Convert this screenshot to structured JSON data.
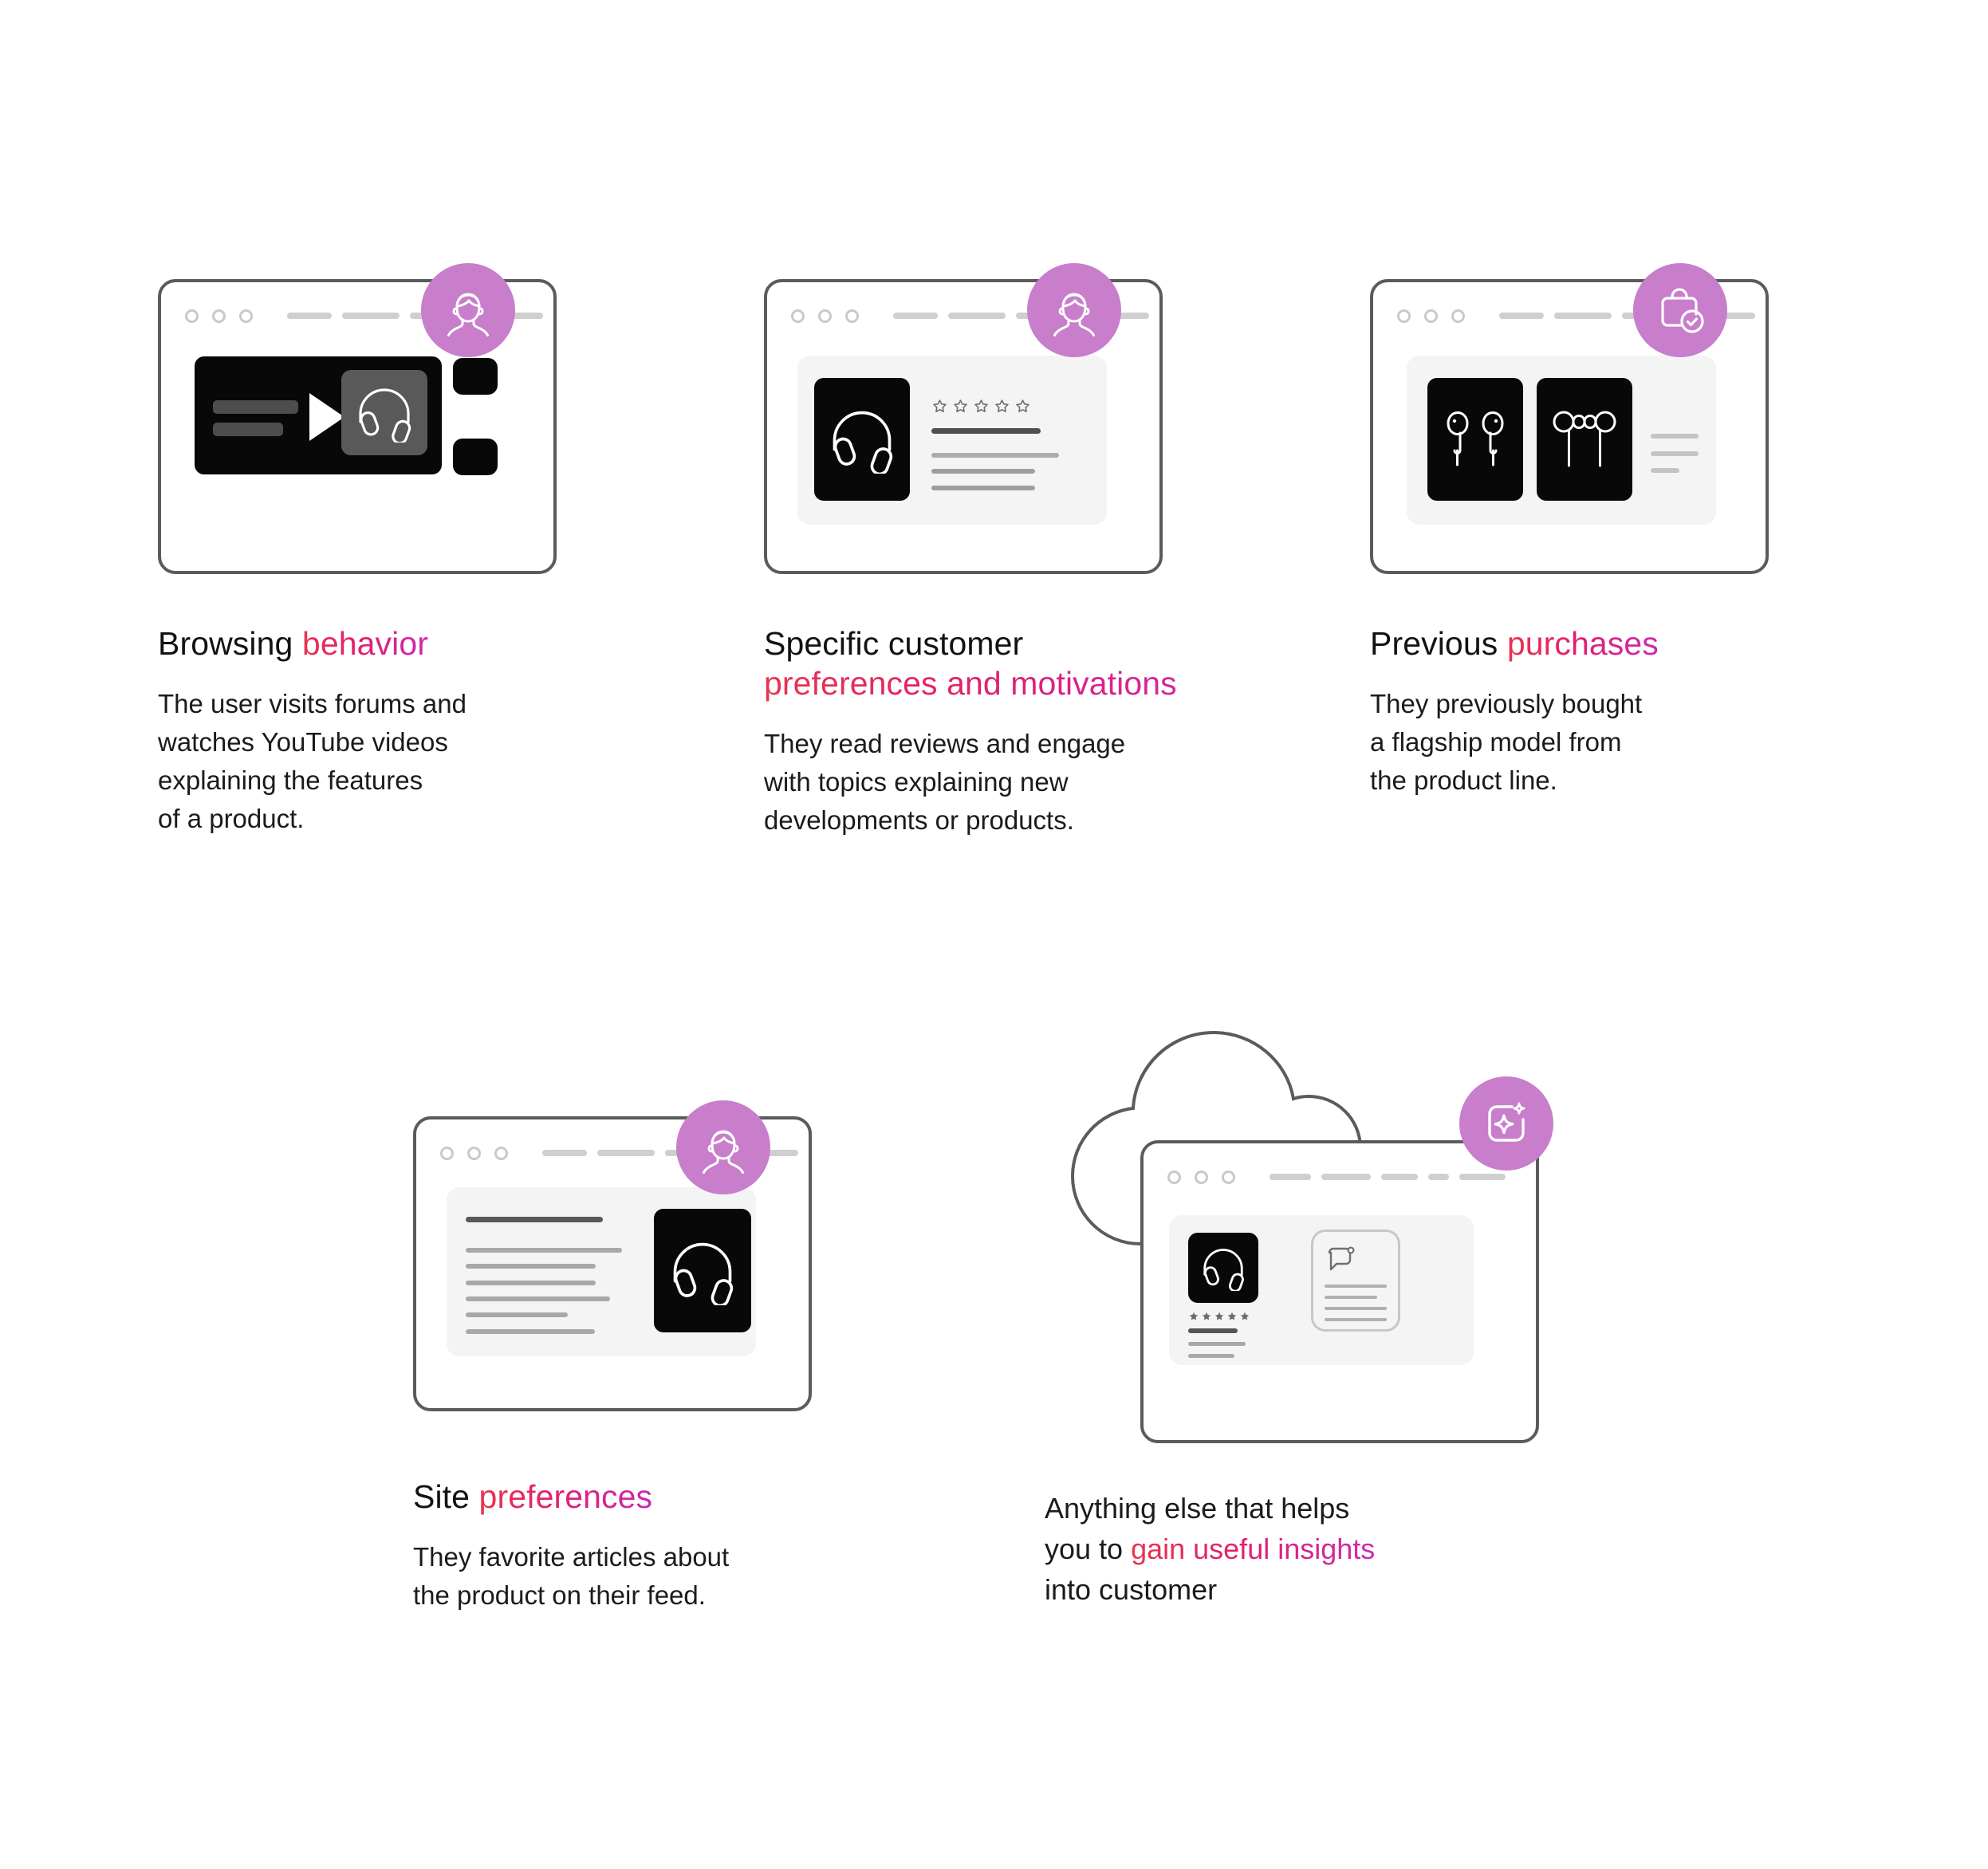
{
  "theme": {
    "badge_color": "#C87ECB",
    "accent_from": "#E8344E",
    "accent_to": "#CC28B4",
    "frame_stroke": "#5B5B5B",
    "panel_gray": "#F4F4F4",
    "tile_black": "#080808"
  },
  "cards": [
    {
      "id": "browsing-behavior",
      "badge_icon": "user-avatar-icon",
      "illustration": "video-player-window",
      "headline_plain": "Browsing ",
      "headline_accent": "behavior",
      "body": "The user visits forums and watches YouTube videos explaining the features of a product.",
      "body_lines": [
        "The user visits forums and",
        "watches YouTube videos",
        "explaining the features",
        "of a product."
      ]
    },
    {
      "id": "customer-preferences",
      "badge_icon": "user-avatar-icon",
      "illustration": "product-review-window",
      "headline_plain": "Specific customer",
      "headline_accent": "preferences and motivations",
      "body": "They read reviews and engage with topics explaining new developments or products.",
      "body_lines": [
        "They read reviews and engage",
        "with topics explaining new",
        "developments or products."
      ],
      "rating_stars": 5,
      "rating_style": "outline"
    },
    {
      "id": "previous-purchases",
      "badge_icon": "shopping-bag-check-icon",
      "illustration": "purchased-products-window",
      "headline_plain": "Previous ",
      "headline_accent": "purchases",
      "body": "They previously bought a flagship model from the product line.",
      "body_lines": [
        "They previously bought",
        "a flagship model from",
        "the product line."
      ]
    },
    {
      "id": "site-preferences",
      "badge_icon": "user-avatar-icon",
      "illustration": "article-feed-window",
      "headline_plain": "Site ",
      "headline_accent": "preferences",
      "body": "They favorite articles about the product on their feed.",
      "body_lines": [
        "They favorite articles about",
        "the product on their feed."
      ]
    },
    {
      "id": "customer-insights",
      "badge_icon": "ai-sparkle-icon",
      "illustration": "cloud-insights-window",
      "headline_line1_plain": "Anything else that helps",
      "headline_line2_plain_a": "you to ",
      "headline_line2_accent": "gain useful insights",
      "headline_line3_plain": "into customer",
      "body": "",
      "rating_stars": 5,
      "rating_style": "filled"
    }
  ]
}
